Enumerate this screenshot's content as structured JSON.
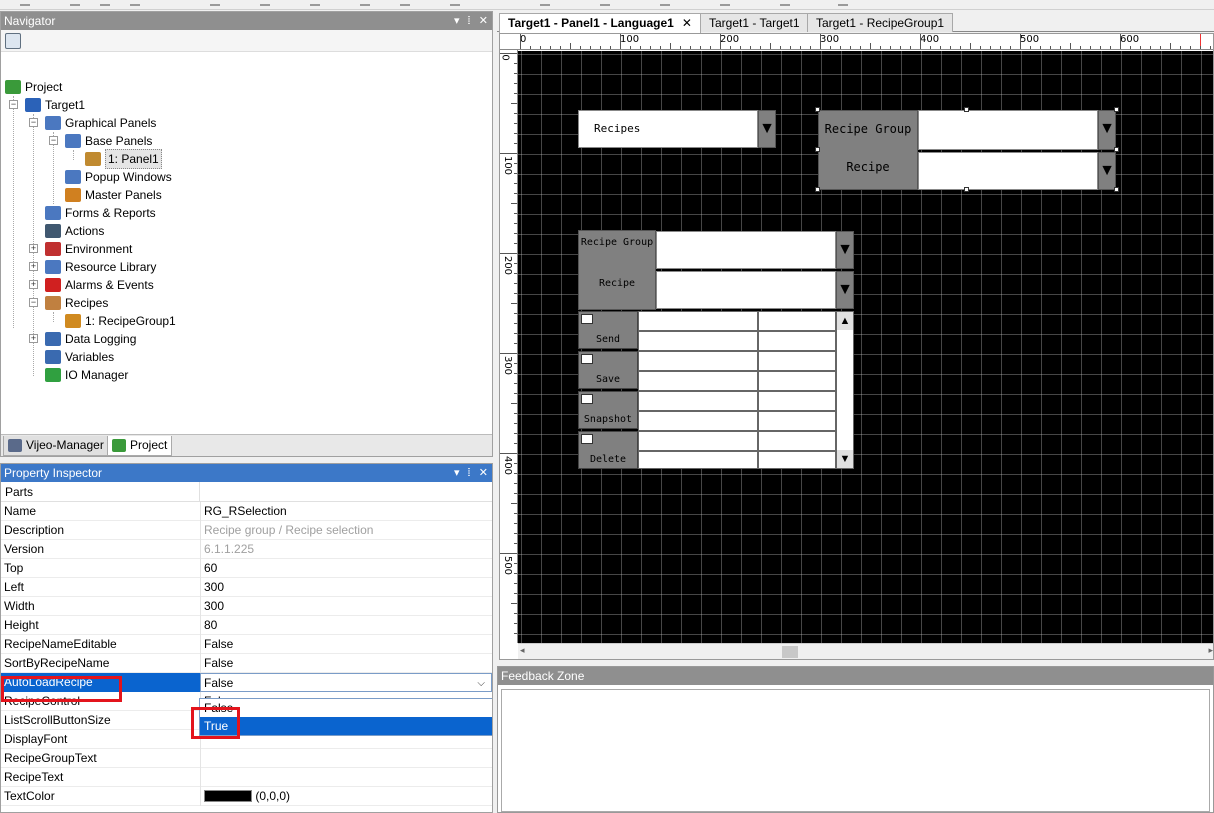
{
  "navigator": {
    "title": "Navigator",
    "title_buttons": [
      "▾",
      "ⵂ",
      "✕"
    ],
    "tree": [
      {
        "label": "Project",
        "icon": "project-icon",
        "color": "#3a9a3a"
      },
      {
        "label": "Target1",
        "icon": "target-icon",
        "color": "#2b62b8"
      },
      {
        "label": "Graphical Panels",
        "icon": "graphical-panels-icon",
        "color": "#4b78c0"
      },
      {
        "label": "Base Panels",
        "icon": "base-panels-icon",
        "color": "#4b78c0"
      },
      {
        "label": "1: Panel1",
        "icon": "panel-icon",
        "color": "#c08a30"
      },
      {
        "label": "Popup Windows",
        "icon": "popup-windows-icon",
        "color": "#4b78c0"
      },
      {
        "label": "Master Panels",
        "icon": "master-panels-icon",
        "color": "#d08020"
      },
      {
        "label": "Forms & Reports",
        "icon": "forms-reports-icon",
        "color": "#4b78c0"
      },
      {
        "label": "Actions",
        "icon": "actions-icon",
        "color": "#405870"
      },
      {
        "label": "Environment",
        "icon": "environment-icon",
        "color": "#c03030"
      },
      {
        "label": "Resource Library",
        "icon": "resource-library-icon",
        "color": "#4b78c0"
      },
      {
        "label": "Alarms & Events",
        "icon": "alarms-events-icon",
        "color": "#d02020"
      },
      {
        "label": "Recipes",
        "icon": "recipes-icon",
        "color": "#c08040"
      },
      {
        "label": "1: RecipeGroup1",
        "icon": "recipe-group-icon",
        "color": "#d08a20"
      },
      {
        "label": "Data Logging",
        "icon": "data-logging-icon",
        "color": "#3a6ab0"
      },
      {
        "label": "Variables",
        "icon": "variables-icon",
        "color": "#3a6ab0"
      },
      {
        "label": "IO Manager",
        "icon": "io-manager-icon",
        "color": "#30a040"
      }
    ],
    "tabs": [
      {
        "label": "Vijeo-Manager",
        "icon": "vijeo-manager-icon"
      },
      {
        "label": "Project",
        "icon": "project-tab-icon"
      }
    ]
  },
  "inspector": {
    "title": "Property Inspector",
    "title_buttons": [
      "▾",
      "ⵂ",
      "✕"
    ],
    "header": "Parts",
    "rows": [
      {
        "name": "Name",
        "value": "RG_RSelection"
      },
      {
        "name": "Description",
        "value": "Recipe group / Recipe selection"
      },
      {
        "name": "Version",
        "value": "6.1.1.225"
      },
      {
        "name": "Top",
        "value": "60"
      },
      {
        "name": "Left",
        "value": "300"
      },
      {
        "name": "Width",
        "value": "300"
      },
      {
        "name": "Height",
        "value": "80"
      },
      {
        "name": "RecipeNameEditable",
        "value": "False"
      },
      {
        "name": "SortByRecipeName",
        "value": "False"
      },
      {
        "name": "AutoLoadRecipe",
        "value": "False"
      },
      {
        "name": "RecipeControl",
        "value": "False"
      },
      {
        "name": "ListScrollButtonSize",
        "value": ""
      },
      {
        "name": "DisplayFont",
        "value": ""
      },
      {
        "name": "RecipeGroupText",
        "value": ""
      },
      {
        "name": "RecipeText",
        "value": ""
      },
      {
        "name": "TextColor",
        "value": "(0,0,0)"
      }
    ],
    "dropdown_options": [
      "False",
      "True"
    ],
    "dropdown_chevron": "⌵",
    "text_color_swatch": "#000000"
  },
  "doc_tabs": [
    {
      "label": "Target1 - Panel1 - Language1",
      "close": "✕"
    },
    {
      "label": "Target1 - Target1"
    },
    {
      "label": "Target1 - RecipeGroup1"
    }
  ],
  "rulers": {
    "h_labels": [
      "0",
      "100",
      "200",
      "300",
      "400",
      "500",
      "600"
    ],
    "v_labels": [
      "0",
      "100",
      "200",
      "300",
      "400",
      "500"
    ]
  },
  "canvas": {
    "recipes_label": "Recipes",
    "recipe_group_label_1": "Recipe Group",
    "recipe_label_1": "Recipe",
    "recipe_group_label_2": "Recipe Group",
    "recipe_label_2": "Recipe",
    "down_arrow": "▼",
    "up_arrow": "▲",
    "buttons": [
      "Send",
      "Save",
      "Snapshot",
      "Delete"
    ]
  },
  "feedback": {
    "title": "Feedback Zone"
  },
  "hscroll": {
    "left_arrow": "◂",
    "right_arrow": "▸"
  }
}
